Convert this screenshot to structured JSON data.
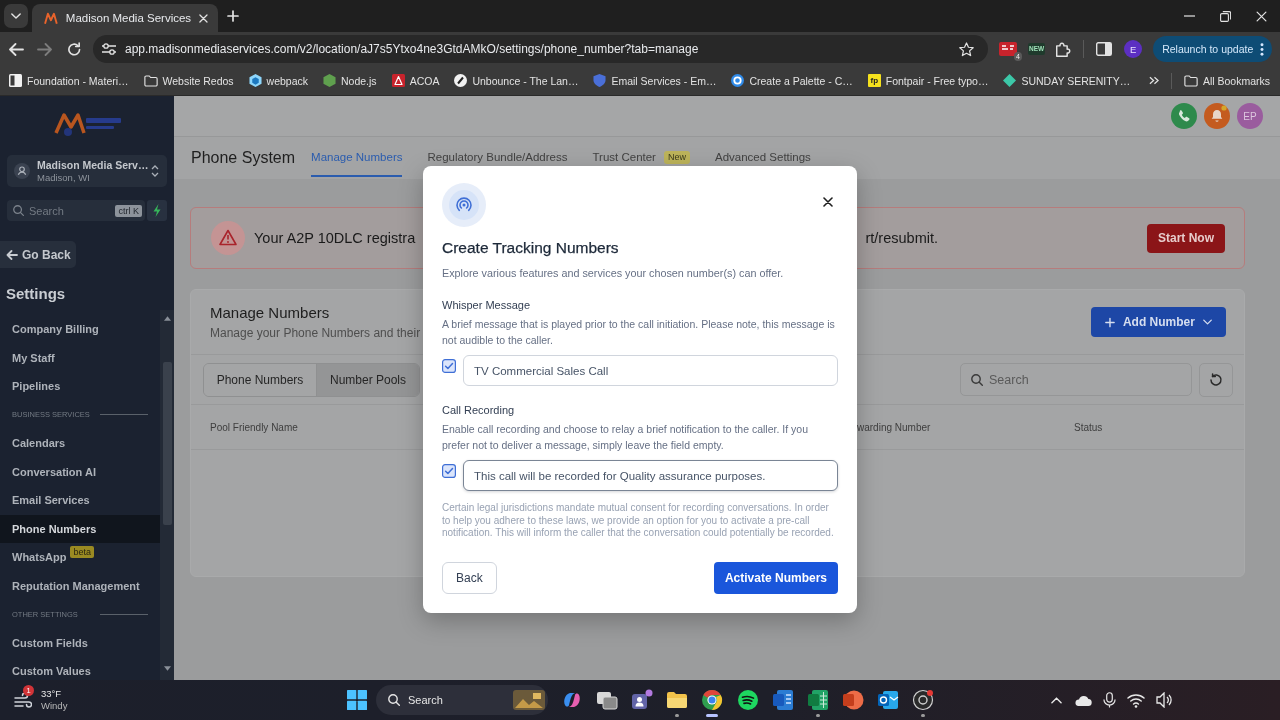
{
  "browser": {
    "tabs": [
      {
        "title": "Madison Media Services",
        "selected": true
      }
    ],
    "address": "app.madisonmediaservices.com/v2/location/aJ7s5Ytxo4ne3GtdAMkO/settings/phone_number?tab=manage",
    "extension_badge": "4",
    "extension_label": "NEW",
    "profile_initial": "E",
    "relaunch": "Relaunch to update",
    "bookmarks": [
      {
        "label": "Foundation - Materi…",
        "kind": "page"
      },
      {
        "label": "Website Redos",
        "kind": "folder"
      },
      {
        "label": "webpack",
        "kind": "page"
      },
      {
        "label": "Node.js",
        "kind": "page"
      },
      {
        "label": "ACOA",
        "kind": "page"
      },
      {
        "label": "Unbounce - The Lan…",
        "kind": "page"
      },
      {
        "label": "Email Services - Em…",
        "kind": "page"
      },
      {
        "label": "Create a Palette - C…",
        "kind": "page"
      },
      {
        "label": "Fontpair - Free typo…",
        "kind": "page",
        "icon_text": "fp"
      },
      {
        "label": "SUNDAY SERENITY…",
        "kind": "page"
      }
    ],
    "all_bookmarks": "All Bookmarks"
  },
  "sidebar": {
    "account": {
      "name": "Madison Media Serv…",
      "location": "Madison, WI"
    },
    "search": {
      "placeholder": "Search",
      "shortcut": "ctrl K"
    },
    "back": "Go Back",
    "heading": "Settings",
    "items": [
      {
        "kind": "item",
        "label": "Company Billing",
        "selected": false
      },
      {
        "kind": "item",
        "label": "My Staff",
        "selected": false
      },
      {
        "kind": "item",
        "label": "Pipelines",
        "selected": false
      },
      {
        "kind": "section",
        "label": "BUSINESS SERVICES"
      },
      {
        "kind": "item",
        "label": "Calendars",
        "selected": false
      },
      {
        "kind": "item",
        "label": "Conversation AI",
        "selected": false
      },
      {
        "kind": "item",
        "label": "Email Services",
        "selected": false
      },
      {
        "kind": "item",
        "label": "Phone Numbers",
        "selected": true
      },
      {
        "kind": "item",
        "label": "WhatsApp",
        "badge": "beta",
        "selected": false
      },
      {
        "kind": "item",
        "label": "Reputation Management",
        "selected": false
      },
      {
        "kind": "section",
        "label": "OTHER SETTINGS"
      },
      {
        "kind": "item",
        "label": "Custom Fields",
        "selected": false
      },
      {
        "kind": "item",
        "label": "Custom Values",
        "selected": false
      }
    ]
  },
  "header": {
    "avatar": "EP"
  },
  "page": {
    "title": "Phone System",
    "tabs": [
      {
        "label": "Manage Numbers",
        "selected": true
      },
      {
        "label": "Regulatory Bundle/Address",
        "selected": false
      },
      {
        "label": "Trust Center",
        "badge": "New",
        "selected": false
      },
      {
        "label": "Advanced Settings",
        "selected": false
      }
    ]
  },
  "banner": {
    "text_start": "Your A2P 10DLC registra",
    "text_end": "rt/resubmit.",
    "button": "Start Now"
  },
  "card": {
    "title": "Manage Numbers",
    "subtitle": "Manage your Phone Numbers and their",
    "add_button": "Add Number",
    "tabs": [
      {
        "label": "Phone Numbers",
        "selected": false
      },
      {
        "label": "Number Pools",
        "selected": true
      }
    ],
    "search": {
      "placeholder": "Search"
    },
    "table": {
      "columns": [
        "Pool Friendly Name",
        "warding Number",
        "Status"
      ]
    }
  },
  "dialog": {
    "title": "Create Tracking Numbers",
    "subtitle": "Explore various features and services your chosen number(s) can offer.",
    "sections": [
      {
        "label": "Whisper Message",
        "description": "A brief message that is played prior to the call initiation. Please note, this message is not audible to the caller.",
        "checked": true,
        "value": "TV Commercial Sales Call",
        "focused": false
      },
      {
        "label": "Call Recording",
        "description": "Enable call recording and choose to relay a brief notification to the caller. If you prefer not to deliver a message, simply leave the field empty.",
        "checked": true,
        "value": "This call will be recorded for Quality assurance purposes.",
        "focused": true
      }
    ],
    "note": "Certain legal jurisdictions mandate mutual consent for recording conversations. In order to help you adhere to these laws, we provide an option for you to activate a pre-call notification. This will inform the caller that the conversation could potentially be recorded.",
    "buttons": [
      {
        "label": "Back",
        "kind": "secondary"
      },
      {
        "label": "Activate Numbers",
        "kind": "primary"
      }
    ]
  },
  "taskbar": {
    "weather": {
      "badge": "1",
      "temperature": "33°F",
      "condition": "Windy"
    },
    "search": {
      "placeholder": "Search"
    },
    "apps": [
      {
        "open": false,
        "selected": false
      },
      {
        "open": false,
        "selected": false
      },
      {
        "open": false,
        "selected": false
      },
      {
        "open": true,
        "selected": false
      },
      {
        "open": true,
        "selected": true
      },
      {
        "open": false,
        "selected": false
      },
      {
        "open": false,
        "selected": false
      },
      {
        "open": true,
        "selected": false
      },
      {
        "open": false,
        "selected": false
      },
      {
        "open": false,
        "selected": false
      },
      {
        "open": true,
        "selected": false
      }
    ]
  }
}
